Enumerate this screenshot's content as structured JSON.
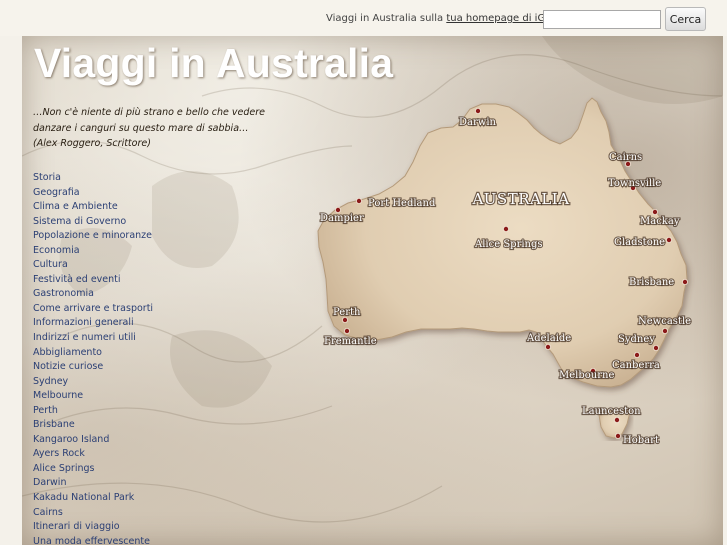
{
  "topbar": {
    "igoogle_prefix": "Viaggi in Australia sulla",
    "igoogle_link": "tua homepage di iGoogle",
    "search_placeholder": "",
    "search_button": "Cerca"
  },
  "site": {
    "title": "Viaggi in Australia",
    "quote": "…Non c'è niente di più strano e bello che vedere danzare i canguri su questo mare di sabbia… (Alex Roggero, Scrittore)"
  },
  "nav": [
    "Storia",
    "Geografia",
    "Clima e Ambiente",
    "Sistema di Governo",
    "Popolazione e minoranze",
    "Economia",
    "Cultura",
    "Festività ed eventi",
    "Gastronomia",
    "Come arrivare e trasporti",
    "Informazioni generali",
    "Indirizzi e numeri utili",
    "Abbigliamento",
    "Notizie curiose",
    "Sydney",
    "Melbourne",
    "Perth",
    "Brisbane",
    "Kangaroo Island",
    "Ayers Rock",
    "Alice Springs",
    "Darwin",
    "Kakadu National Park",
    "Cairns",
    "Itinerari di viaggio",
    "Una moda effervescente"
  ],
  "map": {
    "country": "AUSTRALIA",
    "cities": {
      "darwin": "Darwin",
      "cairns": "Cairns",
      "townsville": "Townsville",
      "port_hedland": "Port Hedland",
      "dampier": "Dampier",
      "mackay": "Mackay",
      "gladstone": "Gladstone",
      "alice_springs": "Alice Springs",
      "brisbane": "Brisbane",
      "perth": "Perth",
      "fremantle": "Fremantle",
      "newcastle": "Newcastle",
      "adelaide": "Adelaide",
      "sydney": "Sydney",
      "canberra": "Canberra",
      "melbourne": "Melbourne",
      "launceston": "Launceston",
      "hobart": "Hobart"
    }
  },
  "colors": {
    "title": "#ffffff",
    "nav_link": "#2b3f74",
    "city_dot": "#8b1a1a",
    "landmass": "#e3d2b8"
  }
}
